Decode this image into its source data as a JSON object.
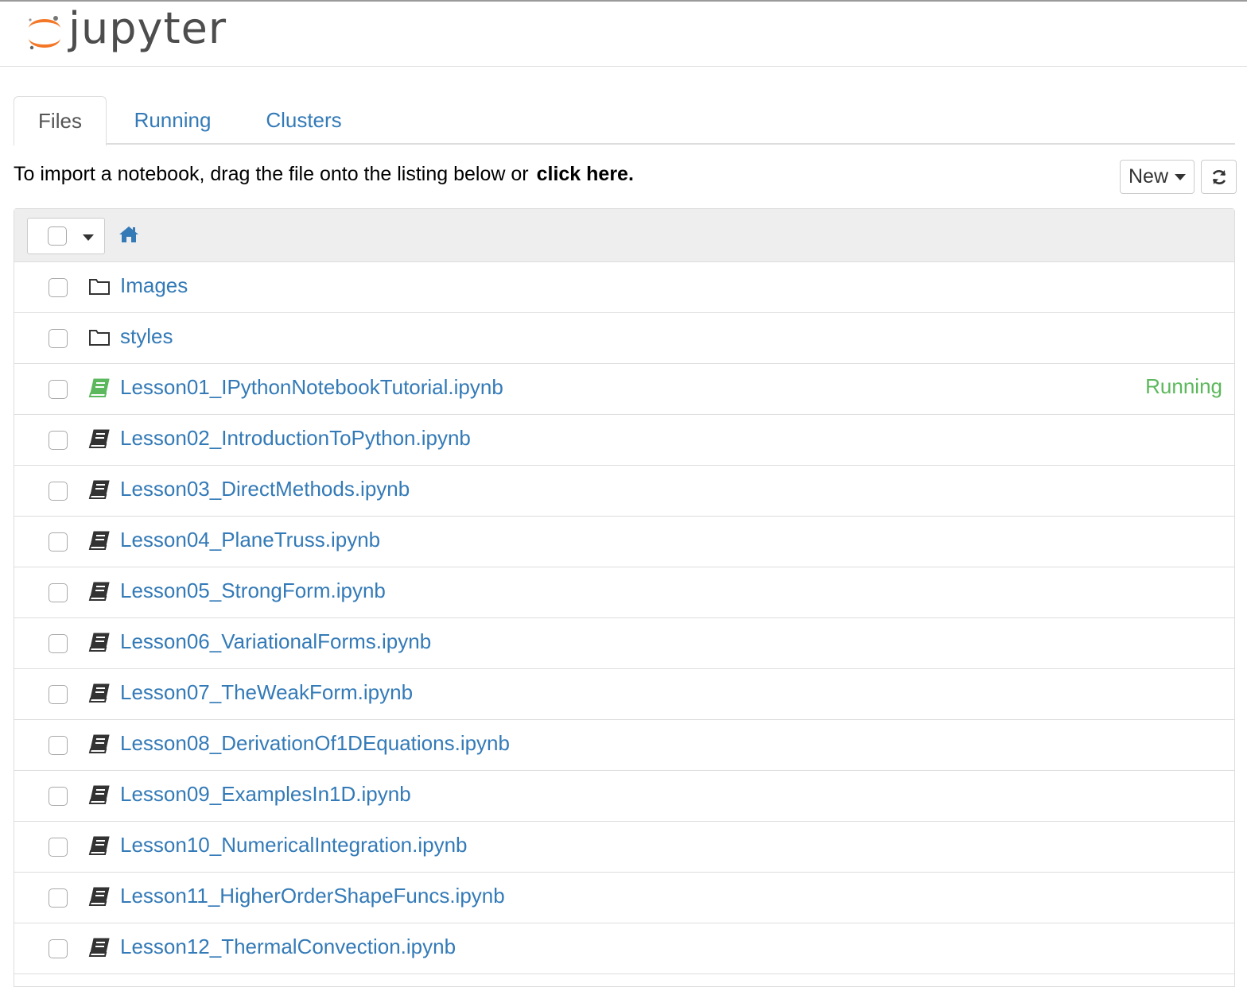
{
  "app": {
    "logo_text": "jupyter"
  },
  "tabs": [
    {
      "label": "Files",
      "active": true
    },
    {
      "label": "Running",
      "active": false
    },
    {
      "label": "Clusters",
      "active": false
    }
  ],
  "toolbar": {
    "import_text": "To import a notebook, drag the file onto the listing below or",
    "import_link": "click here.",
    "new_label": "New",
    "refresh_icon": "refresh-icon"
  },
  "listing": {
    "home_icon": "home-icon",
    "items": [
      {
        "name": "Images",
        "type": "folder",
        "status": ""
      },
      {
        "name": "styles",
        "type": "folder",
        "status": ""
      },
      {
        "name": "Lesson01_IPythonNotebookTutorial.ipynb",
        "type": "notebook-running",
        "status": "Running"
      },
      {
        "name": "Lesson02_IntroductionToPython.ipynb",
        "type": "notebook",
        "status": ""
      },
      {
        "name": "Lesson03_DirectMethods.ipynb",
        "type": "notebook",
        "status": ""
      },
      {
        "name": "Lesson04_PlaneTruss.ipynb",
        "type": "notebook",
        "status": ""
      },
      {
        "name": "Lesson05_StrongForm.ipynb",
        "type": "notebook",
        "status": ""
      },
      {
        "name": "Lesson06_VariationalForms.ipynb",
        "type": "notebook",
        "status": ""
      },
      {
        "name": "Lesson07_TheWeakForm.ipynb",
        "type": "notebook",
        "status": ""
      },
      {
        "name": "Lesson08_DerivationOf1DEquations.ipynb",
        "type": "notebook",
        "status": ""
      },
      {
        "name": "Lesson09_ExamplesIn1D.ipynb",
        "type": "notebook",
        "status": ""
      },
      {
        "name": "Lesson10_NumericalIntegration.ipynb",
        "type": "notebook",
        "status": ""
      },
      {
        "name": "Lesson11_HigherOrderShapeFuncs.ipynb",
        "type": "notebook",
        "status": ""
      },
      {
        "name": "Lesson12_ThermalConvection.ipynb",
        "type": "notebook",
        "status": ""
      }
    ]
  },
  "colors": {
    "link": "#337ab7",
    "running": "#5cb85c",
    "logo_orange": "#f37726",
    "logo_text": "#4d4d4d"
  }
}
